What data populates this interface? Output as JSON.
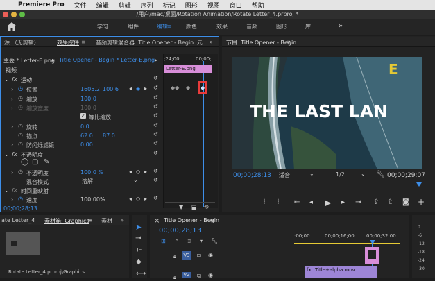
{
  "menubar": {
    "app": "Premiere Pro",
    "items": [
      "文件",
      "编辑",
      "剪辑",
      "序列",
      "标记",
      "图形",
      "视图",
      "窗口",
      "帮助"
    ]
  },
  "titlebar": {
    "path": "/用户/mac/桌面/Rotation Animation/Rotate Letter_4.prproj *"
  },
  "workspaces": {
    "items": [
      "学习",
      "组件",
      "编辑",
      "颜色",
      "效果",
      "音频",
      "图形",
      "库"
    ],
    "active": "编辑"
  },
  "source_panel": {
    "tabs": [
      "源:（无剪辑）",
      "效果控件",
      "音频剪辑混合器: Title Opener - Begin",
      "元"
    ],
    "clip_path": "主要 * Letter-E.png",
    "clip_link": "Title Opener - Begin * Letter-E.png",
    "ruler_time": ";24;00",
    "ruler_time2": "00;00;",
    "clip_bar": "Letter-E.png",
    "section": "视频",
    "motion": "运动",
    "position_label": "位置",
    "position_x": "1605.2",
    "position_y": "100.6",
    "scale_label": "缩放",
    "scale_val": "100.0",
    "scale_width_label": "缩放宽度",
    "scale_width_val": "100.0",
    "uniform_label": "等比缩放",
    "rotation_label": "旋转",
    "rotation_val": "0.0",
    "anchor_label": "锚点",
    "anchor_x": "62.0",
    "anchor_y": "87.0",
    "flicker_label": "防闪烁滤镜",
    "flicker_val": "0.00",
    "opacity_group": "不透明度",
    "opacity_label": "不透明度",
    "opacity_val": "100.0 %",
    "blend_label": "混合模式",
    "blend_val": "溶解",
    "time_remap": "时间重映射",
    "speed_label": "速度",
    "speed_val": "100.00%",
    "timecode": "00;00;28;13"
  },
  "program_panel": {
    "title": "节目: Title Opener - Begin",
    "overlay_text": "THE LAST LAN",
    "overlay_letter": "E",
    "timecode": "00;00;28;13",
    "fit_label": "适合",
    "fraction": "1/2",
    "end_timecode": "00;00;29;07"
  },
  "project_panel": {
    "tab_left": "ate Letter_4",
    "tab_active": "素材箱: Graphics",
    "tab_more": "素材",
    "path": "Rotate Letter_4.prproj\\Graphics"
  },
  "timeline_panel": {
    "title": "Title Opener - Begin",
    "timecode": "00;00;28;13",
    "ruler": [
      ":00;00",
      "00;00;16;00",
      "00;00;32;00"
    ],
    "track_v3": "V3",
    "track_v2": "V2",
    "clip_label": "Title+alpha.mov"
  },
  "meter": {
    "scale": [
      "0",
      "-6",
      "-12",
      "-18",
      "-24",
      "-30"
    ]
  },
  "colors": {
    "accent": "#3d8ee9",
    "keyframe_highlight": "#e83b3b",
    "clip_pink": "#d88ed9",
    "clip_purple": "#9d85d6",
    "letter_yellow": "#e5c934"
  }
}
